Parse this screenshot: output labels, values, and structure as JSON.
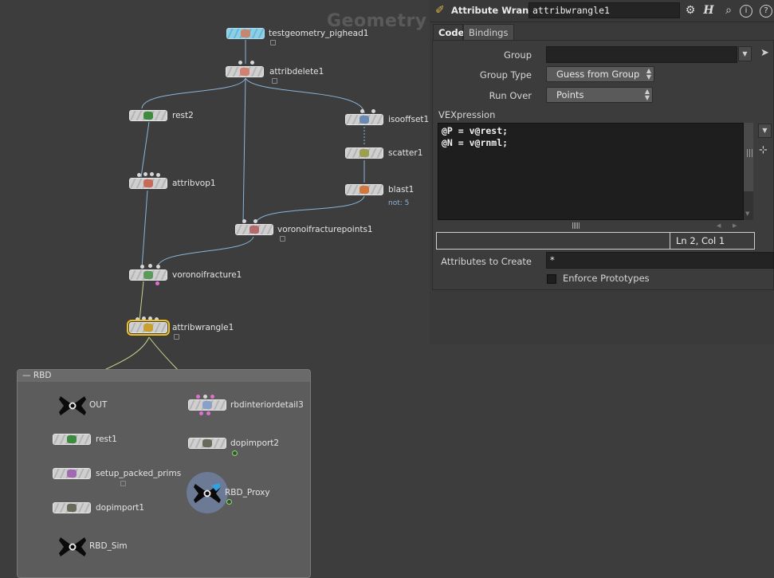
{
  "network": {
    "context_title": "Geometry",
    "nodes": {
      "testgeometry": "testgeometry_pighead1",
      "attribdelete": "attribdelete1",
      "rest2": "rest2",
      "isooffset": "isooffset1",
      "scatter": "scatter1",
      "blast": "blast1",
      "blast_comment": "not: 5",
      "attribvop": "attribvop1",
      "voronoipoints": "voronoifracturepoints1",
      "voronoi": "voronoifracture1",
      "attribwrangle": "attribwrangle1"
    },
    "netbox": {
      "title": "RBD",
      "nodes": {
        "out": "OUT",
        "rest1": "rest1",
        "setup": "setup_packed_prims",
        "dopimport1": "dopimport1",
        "rbdsim": "RBD_Sim",
        "rbdinterior": "rbdinteriordetail3",
        "dopimport2": "dopimport2",
        "rbdproxy": "RBD_Proxy"
      }
    }
  },
  "parameters": {
    "node_type": "Attribute Wrangle",
    "node_name": "attribwrangle1",
    "tabs": [
      "Code",
      "Bindings"
    ],
    "group_label": "Group",
    "group_value": "",
    "group_type_label": "Group Type",
    "group_type_value": "Guess from Group",
    "run_over_label": "Run Over",
    "run_over_value": "Points",
    "vexpression_label": "VEXpression",
    "code_lines": [
      "@P = v@rest;",
      "@N = v@rnml;"
    ],
    "cursor_pos": "Ln 2, Col 1",
    "attributes_to_create_label": "Attributes to Create",
    "attributes_to_create_value": "*",
    "enforce_prototypes_label": "Enforce Prototypes",
    "enforce_prototypes_checked": false
  },
  "icons": {
    "toolbar": [
      "gear-icon",
      "help-h-icon",
      "search-icon",
      "info-icon",
      "question-icon"
    ]
  },
  "colors": {
    "selected_outline": "#f0c020",
    "wire": "#8ab4d8",
    "wire_selected": "#c8d68a",
    "accent_orange": "#d9b24a"
  }
}
